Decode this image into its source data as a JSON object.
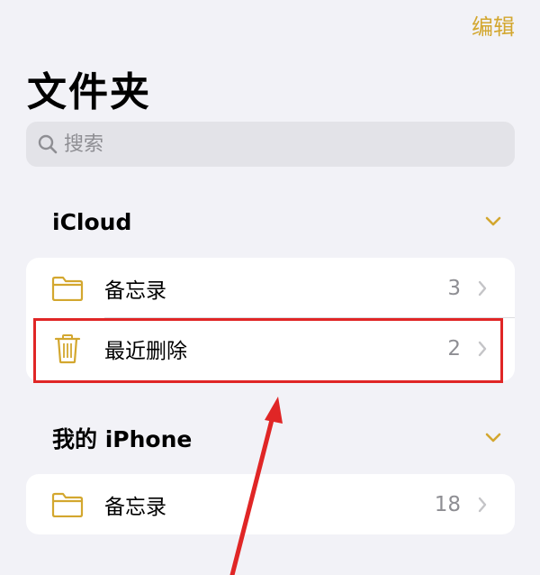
{
  "header": {
    "edit_label": "编辑",
    "title": "文件夹"
  },
  "search": {
    "placeholder": "搜索"
  },
  "sections": [
    {
      "title": "iCloud",
      "items": [
        {
          "label": "备忘录",
          "count": "3",
          "icon": "folder-icon"
        },
        {
          "label": "最近删除",
          "count": "2",
          "icon": "trash-icon"
        }
      ]
    },
    {
      "title": "我的 iPhone",
      "items": [
        {
          "label": "备忘录",
          "count": "18",
          "icon": "folder-icon"
        }
      ]
    }
  ],
  "colors": {
    "accent": "#d3a72f",
    "annotation": "#e02626",
    "background": "#f2f2f7"
  }
}
